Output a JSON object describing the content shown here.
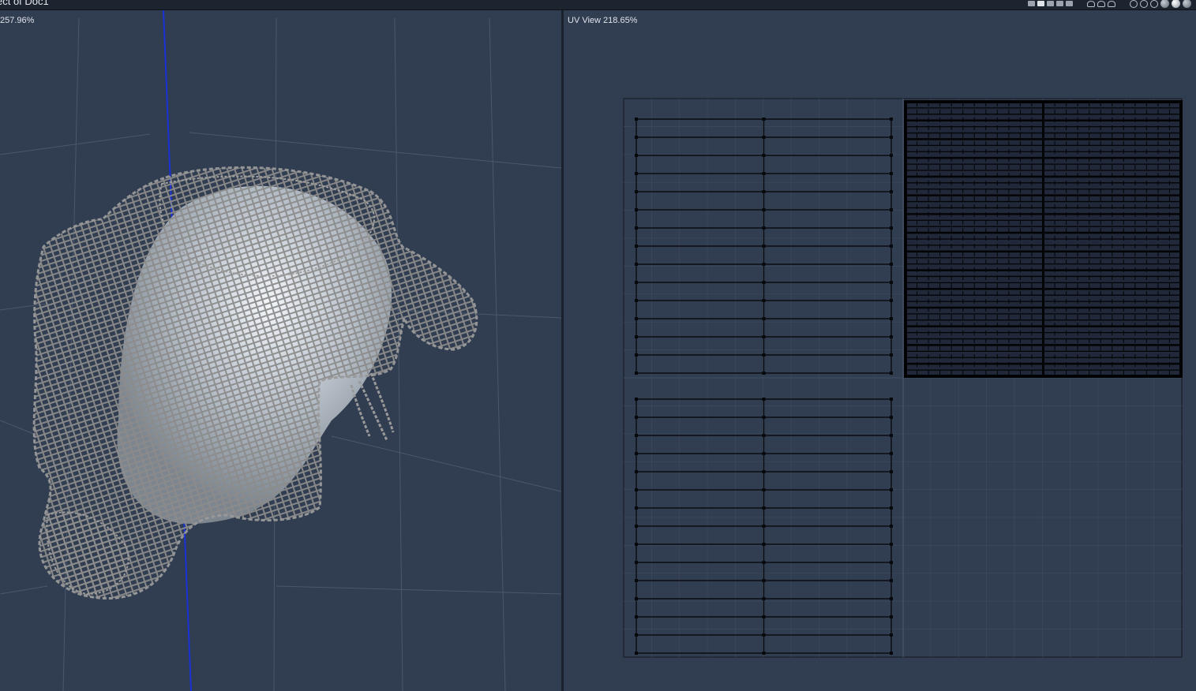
{
  "window": {
    "title": "ect of Doc1"
  },
  "toolbar": {
    "icons": [
      "layout-single-icon",
      "layout-split-icon",
      "layout-quad-icon",
      "layout-triple-icon",
      "layout-wide-icon",
      "wireframe-mode-icon",
      "shaded-mode-icon",
      "textured-mode-icon",
      "move-tool-icon",
      "rotate-tool-icon",
      "scale-tool-icon",
      "light-ball-icon",
      "material-ball-icon",
      "render-ball-icon"
    ]
  },
  "viewport3d": {
    "zoom_label": "257.96%",
    "axis_color": "#1a32d8",
    "mesh_color": "#8c8c8c"
  },
  "uvview": {
    "label": "UV View 218.65%",
    "quadrants": [
      {
        "name": "top-left",
        "style": "sparse-grid"
      },
      {
        "name": "top-right",
        "style": "dense-grid"
      },
      {
        "name": "bottom-left",
        "style": "sparse-grid"
      },
      {
        "name": "bottom-right",
        "style": "empty"
      }
    ]
  }
}
